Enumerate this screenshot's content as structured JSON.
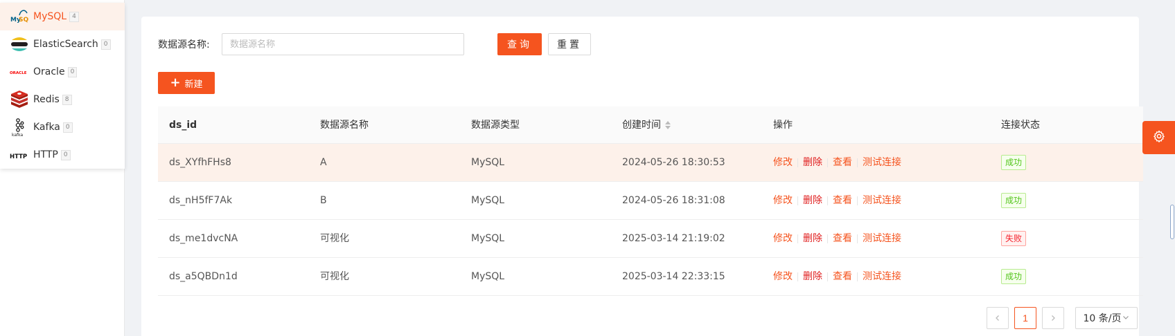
{
  "sidebar": {
    "items": [
      {
        "label": "MySQL",
        "count": "4",
        "icon": "mysql-logo"
      },
      {
        "label": "ElasticSearch",
        "count": "0",
        "icon": "elasticsearch-logo"
      },
      {
        "label": "Oracle",
        "count": "0",
        "icon": "oracle-logo"
      },
      {
        "label": "Redis",
        "count": "8",
        "icon": "redis-logo"
      },
      {
        "label": "Kafka",
        "count": "0",
        "icon": "kafka-logo"
      },
      {
        "label": "HTTP",
        "count": "0",
        "icon": "http-logo"
      }
    ],
    "active_item": "MySQL"
  },
  "search": {
    "label": "数据源名称:",
    "placeholder": "数据源名称",
    "value": "",
    "query_label": "查询",
    "reset_label": "重置"
  },
  "toolbar": {
    "new_label": "新建"
  },
  "table": {
    "headers": {
      "id": "ds_id",
      "name": "数据源名称",
      "type": "数据源类型",
      "created": "创建时间",
      "actions": "操作",
      "status": "连接状态"
    },
    "action_labels": {
      "edit": "修改",
      "delete": "删除",
      "view": "查看",
      "test": "测试连接"
    },
    "rows": [
      {
        "id": "ds_XYfhFHs8",
        "name": "A",
        "type": "MySQL",
        "created": "2024-05-26 18:30:53",
        "status": "成功"
      },
      {
        "id": "ds_nH5fF7Ak",
        "name": "B",
        "type": "MySQL",
        "created": "2024-05-26 18:31:08",
        "status": "成功"
      },
      {
        "id": "ds_me1dvcNA",
        "name": "可视化",
        "type": "MySQL",
        "created": "2025-03-14 21:19:02",
        "status": "失败"
      },
      {
        "id": "ds_a5QBDn1d",
        "name": "可视化",
        "type": "MySQL",
        "created": "2025-03-14 22:33:15",
        "status": "成功"
      }
    ]
  },
  "pagination": {
    "current_page": "1",
    "page_size": "10 条/页"
  },
  "colors": {
    "accent": "#f5541f",
    "success": "#52c41a",
    "error": "#f5222d"
  }
}
